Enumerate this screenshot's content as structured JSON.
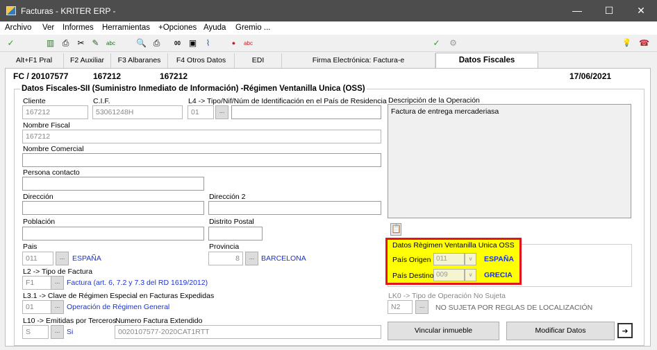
{
  "window": {
    "title": "Facturas - KRITER ERP -"
  },
  "window_controls": {
    "minimize": "—",
    "maximize": "☐",
    "close": "✕"
  },
  "menu": [
    "Archivo",
    "Ver",
    "Informes",
    "Herramientas",
    "+Opciones",
    "Ayuda",
    "Gremio ..."
  ],
  "toolbar_icons": {
    "ok": "✓",
    "barcode": "▥",
    "print": "⎙",
    "scissors": "✂",
    "pen": "✎",
    "abc": "abc",
    "search": "🔍",
    "printer2": "⎙",
    "num": "00",
    "picture": "▣",
    "clip": "⌇",
    "dot": "●",
    "spell": "abc",
    "check2": "✓",
    "tool": "⚙",
    "bulb": "💡",
    "bell": "☎"
  },
  "tabs": [
    "Alt+F1 Pral",
    "F2 Auxiliar",
    "F3 Albaranes",
    "F4 Otros Datos",
    "EDI",
    "Firma Electrónica: Factura-e",
    "Datos Fiscales"
  ],
  "header": {
    "doc": "FC / 20107577",
    "code1": "167212",
    "code2": "167212",
    "date": "17/06/2021"
  },
  "groupbox": {
    "title": "Datos Fiscales-SII (Suministro Inmediato de Información) -Régimen Ventanilla Unica (OSS)"
  },
  "fields": {
    "cliente_label": "Cliente",
    "cliente": "167212",
    "cif_label": "C.I.F.",
    "cif": "53061248H",
    "l4_label": "L4 -> Tipo/Nif/Núm de Identificación en el País de Residencia",
    "l4_tipo": "01",
    "l4_num": "",
    "nombre_fiscal_label": "Nombre Fiscal",
    "nombre_fiscal": "167212",
    "nombre_comercial_label": "Nombre Comercial",
    "nombre_comercial": "",
    "persona_label": "Persona contacto",
    "persona": "",
    "direccion_label": "Dirección",
    "direccion": "",
    "direccion2_label": "Dirección 2",
    "direccion2": "",
    "poblacion_label": "Población",
    "poblacion": "",
    "cp_label": "Distrito Postal",
    "cp": "",
    "pais_label": "Pais",
    "pais_code": "011",
    "pais_name": "ESPAÑA",
    "provincia_label": "Provincia",
    "provincia_code": "8",
    "provincia_name": "BARCELONA",
    "l2_label": "L2 -> Tipo de Factura",
    "l2_code": "F1",
    "l2_desc": "Factura (art. 6, 7.2 y 7.3 del RD 1619/2012)",
    "l31_label": "L3.1 -> Clave de Régimen Especial en Facturas Expedidas",
    "l31_code": "01",
    "l31_desc": "Operación de Régimen General",
    "l10_label": "L10 -> Emitidas por Terceros",
    "l10_code": "S",
    "l10_desc": "Si",
    "num_ext_label": "Numero Factura Extendido",
    "num_ext": "0020107577-2020CAT1RTT",
    "desc_op_label": "Descripción de la Operación",
    "desc_op": "Factura de entrega mercaderiasa",
    "lk0_label": "LK0 -> Tipo de Operación No Sujeta",
    "lk0_code": "N2",
    "lk0_desc": "NO SUJETA POR REGLAS DE LOCALIZACIÓN",
    "lookup": "..."
  },
  "oss": {
    "title": "Datos Règimen Ventanilla Unica OSS",
    "origen_label": "País Origen",
    "origen_code": "011",
    "origen_name": "ESPAÑA",
    "destino_label": "País Destino",
    "destino_code": "009",
    "destino_name": "GRECIA",
    "dropdown": "∨"
  },
  "buttons": {
    "vincular": "Vincular inmueble",
    "modificar": "Modificar Datos",
    "next": "➔",
    "clip": "📋"
  }
}
